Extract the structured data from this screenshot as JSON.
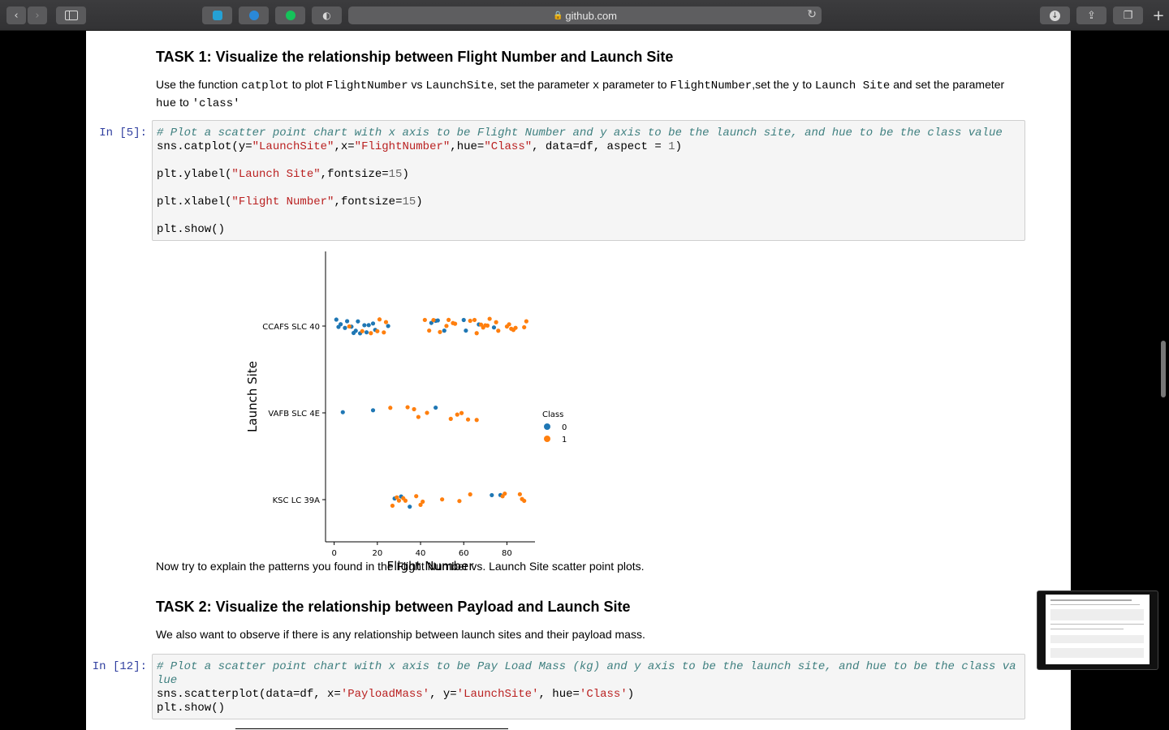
{
  "browser": {
    "url": "github.com",
    "back_icon": "chevron-left-icon",
    "forward_icon": "chevron-right-icon"
  },
  "task1": {
    "heading": "TASK 1: Visualize the relationship between Flight Number and Launch Site",
    "desc": {
      "p1": "Use the function ",
      "c1": "catplot",
      "p2": " to plot ",
      "c2": "FlightNumber",
      "p3": " vs ",
      "c3": "LaunchSite",
      "p4": ", set the parameter ",
      "c4": "x",
      "p5": " parameter to ",
      "c5": "FlightNumber",
      "p6": ",set the ",
      "c6": "y",
      "p7": " to ",
      "c7": "Launch Site",
      "p8": " and set the parameter",
      "c8": "hue",
      "p9": " to ",
      "c9": "'class'"
    }
  },
  "cell5": {
    "prompt": "In [5]:",
    "comment": "# Plot a scatter point chart with x axis to be Flight Number and y axis to be the launch site, and hue to be the class value",
    "l2": {
      "a": "sns.catplot(y=",
      "b": "\"LaunchSite\"",
      "c": ",x=",
      "d": "\"FlightNumber\"",
      "e": ",hue=",
      "f": "\"Class\"",
      "g": ", data=df, aspect = ",
      "h": "1",
      "i": ")"
    },
    "l3": {
      "a": "plt.ylabel(",
      "b": "\"Launch Site\"",
      "c": ",fontsize=",
      "d": "15",
      "e": ")"
    },
    "l4": {
      "a": "plt.xlabel(",
      "b": "\"Flight Number\"",
      "c": ",fontsize=",
      "d": "15",
      "e": ")"
    },
    "l5": "plt.show()"
  },
  "chart_data": {
    "type": "scatter",
    "xlabel": "Flight Number",
    "ylabel": "Launch Site",
    "xlim": [
      -4,
      93
    ],
    "x_ticks": [
      0,
      20,
      40,
      60,
      80
    ],
    "categories": [
      "CCAFS SLC 40",
      "VAFB SLC 4E",
      "KSC LC 39A"
    ],
    "legend_title": "Class",
    "legend_position": "right",
    "colors": {
      "0": "#1f77b4",
      "1": "#ff7f0e"
    },
    "series": [
      {
        "name": "0",
        "points": [
          {
            "x": 1,
            "y": "CCAFS SLC 40"
          },
          {
            "x": 2,
            "y": "CCAFS SLC 40"
          },
          {
            "x": 3,
            "y": "CCAFS SLC 40"
          },
          {
            "x": 5,
            "y": "CCAFS SLC 40"
          },
          {
            "x": 6,
            "y": "CCAFS SLC 40"
          },
          {
            "x": 8,
            "y": "CCAFS SLC 40"
          },
          {
            "x": 9,
            "y": "CCAFS SLC 40"
          },
          {
            "x": 10,
            "y": "CCAFS SLC 40"
          },
          {
            "x": 11,
            "y": "CCAFS SLC 40"
          },
          {
            "x": 12,
            "y": "CCAFS SLC 40"
          },
          {
            "x": 14,
            "y": "CCAFS SLC 40"
          },
          {
            "x": 15,
            "y": "CCAFS SLC 40"
          },
          {
            "x": 16,
            "y": "CCAFS SLC 40"
          },
          {
            "x": 18,
            "y": "CCAFS SLC 40"
          },
          {
            "x": 19,
            "y": "CCAFS SLC 40"
          },
          {
            "x": 25,
            "y": "CCAFS SLC 40"
          },
          {
            "x": 45,
            "y": "CCAFS SLC 40"
          },
          {
            "x": 47,
            "y": "CCAFS SLC 40"
          },
          {
            "x": 48,
            "y": "CCAFS SLC 40"
          },
          {
            "x": 51,
            "y": "CCAFS SLC 40"
          },
          {
            "x": 60,
            "y": "CCAFS SLC 40"
          },
          {
            "x": 61,
            "y": "CCAFS SLC 40"
          },
          {
            "x": 67,
            "y": "CCAFS SLC 40"
          },
          {
            "x": 74,
            "y": "CCAFS SLC 40"
          },
          {
            "x": 4,
            "y": "VAFB SLC 4E"
          },
          {
            "x": 18,
            "y": "VAFB SLC 4E"
          },
          {
            "x": 47,
            "y": "VAFB SLC 4E"
          },
          {
            "x": 28,
            "y": "KSC LC 39A"
          },
          {
            "x": 31,
            "y": "KSC LC 39A"
          },
          {
            "x": 35,
            "y": "KSC LC 39A"
          },
          {
            "x": 73,
            "y": "KSC LC 39A"
          },
          {
            "x": 77,
            "y": "KSC LC 39A"
          }
        ]
      },
      {
        "name": "1",
        "points": [
          {
            "x": 7,
            "y": "CCAFS SLC 40"
          },
          {
            "x": 13,
            "y": "CCAFS SLC 40"
          },
          {
            "x": 17,
            "y": "CCAFS SLC 40"
          },
          {
            "x": 20,
            "y": "CCAFS SLC 40"
          },
          {
            "x": 21,
            "y": "CCAFS SLC 40"
          },
          {
            "x": 23,
            "y": "CCAFS SLC 40"
          },
          {
            "x": 24,
            "y": "CCAFS SLC 40"
          },
          {
            "x": 42,
            "y": "CCAFS SLC 40"
          },
          {
            "x": 44,
            "y": "CCAFS SLC 40"
          },
          {
            "x": 46,
            "y": "CCAFS SLC 40"
          },
          {
            "x": 49,
            "y": "CCAFS SLC 40"
          },
          {
            "x": 52,
            "y": "CCAFS SLC 40"
          },
          {
            "x": 53,
            "y": "CCAFS SLC 40"
          },
          {
            "x": 55,
            "y": "CCAFS SLC 40"
          },
          {
            "x": 56,
            "y": "CCAFS SLC 40"
          },
          {
            "x": 63,
            "y": "CCAFS SLC 40"
          },
          {
            "x": 65,
            "y": "CCAFS SLC 40"
          },
          {
            "x": 66,
            "y": "CCAFS SLC 40"
          },
          {
            "x": 68,
            "y": "CCAFS SLC 40"
          },
          {
            "x": 69,
            "y": "CCAFS SLC 40"
          },
          {
            "x": 70,
            "y": "CCAFS SLC 40"
          },
          {
            "x": 71,
            "y": "CCAFS SLC 40"
          },
          {
            "x": 72,
            "y": "CCAFS SLC 40"
          },
          {
            "x": 75,
            "y": "CCAFS SLC 40"
          },
          {
            "x": 76,
            "y": "CCAFS SLC 40"
          },
          {
            "x": 80,
            "y": "CCAFS SLC 40"
          },
          {
            "x": 81,
            "y": "CCAFS SLC 40"
          },
          {
            "x": 82,
            "y": "CCAFS SLC 40"
          },
          {
            "x": 83,
            "y": "CCAFS SLC 40"
          },
          {
            "x": 84,
            "y": "CCAFS SLC 40"
          },
          {
            "x": 88,
            "y": "CCAFS SLC 40"
          },
          {
            "x": 89,
            "y": "CCAFS SLC 40"
          },
          {
            "x": 26,
            "y": "VAFB SLC 4E"
          },
          {
            "x": 34,
            "y": "VAFB SLC 4E"
          },
          {
            "x": 37,
            "y": "VAFB SLC 4E"
          },
          {
            "x": 39,
            "y": "VAFB SLC 4E"
          },
          {
            "x": 43,
            "y": "VAFB SLC 4E"
          },
          {
            "x": 54,
            "y": "VAFB SLC 4E"
          },
          {
            "x": 57,
            "y": "VAFB SLC 4E"
          },
          {
            "x": 59,
            "y": "VAFB SLC 4E"
          },
          {
            "x": 62,
            "y": "VAFB SLC 4E"
          },
          {
            "x": 66,
            "y": "VAFB SLC 4E"
          },
          {
            "x": 27,
            "y": "KSC LC 39A"
          },
          {
            "x": 29,
            "y": "KSC LC 39A"
          },
          {
            "x": 30,
            "y": "KSC LC 39A"
          },
          {
            "x": 32,
            "y": "KSC LC 39A"
          },
          {
            "x": 33,
            "y": "KSC LC 39A"
          },
          {
            "x": 38,
            "y": "KSC LC 39A"
          },
          {
            "x": 40,
            "y": "KSC LC 39A"
          },
          {
            "x": 41,
            "y": "KSC LC 39A"
          },
          {
            "x": 50,
            "y": "KSC LC 39A"
          },
          {
            "x": 58,
            "y": "KSC LC 39A"
          },
          {
            "x": 63,
            "y": "KSC LC 39A"
          },
          {
            "x": 78,
            "y": "KSC LC 39A"
          },
          {
            "x": 79,
            "y": "KSC LC 39A"
          },
          {
            "x": 86,
            "y": "KSC LC 39A"
          },
          {
            "x": 87,
            "y": "KSC LC 39A"
          },
          {
            "x": 88,
            "y": "KSC LC 39A"
          }
        ]
      }
    ]
  },
  "explain": "Now try to explain the patterns you found in the Flight Number vs. Launch Site scatter point plots.",
  "task2": {
    "heading": "TASK 2: Visualize the relationship between Payload and Launch Site",
    "desc": "We also want to observe if there is any relationship between launch sites and their payload mass."
  },
  "cell12": {
    "prompt": "In [12]:",
    "comment1": "# Plot a scatter point chart with x axis to be Pay Load Mass (kg) and y axis to be the launch site, and hue to be the class va",
    "comment2": "lue",
    "l2": {
      "a": "sns.scatterplot(data=df, x=",
      "b": "'PayloadMass'",
      "c": ", y=",
      "d": "'LaunchSite'",
      "e": ", hue=",
      "f": "'Class'",
      "g": ")"
    },
    "l3": "plt.show()"
  }
}
